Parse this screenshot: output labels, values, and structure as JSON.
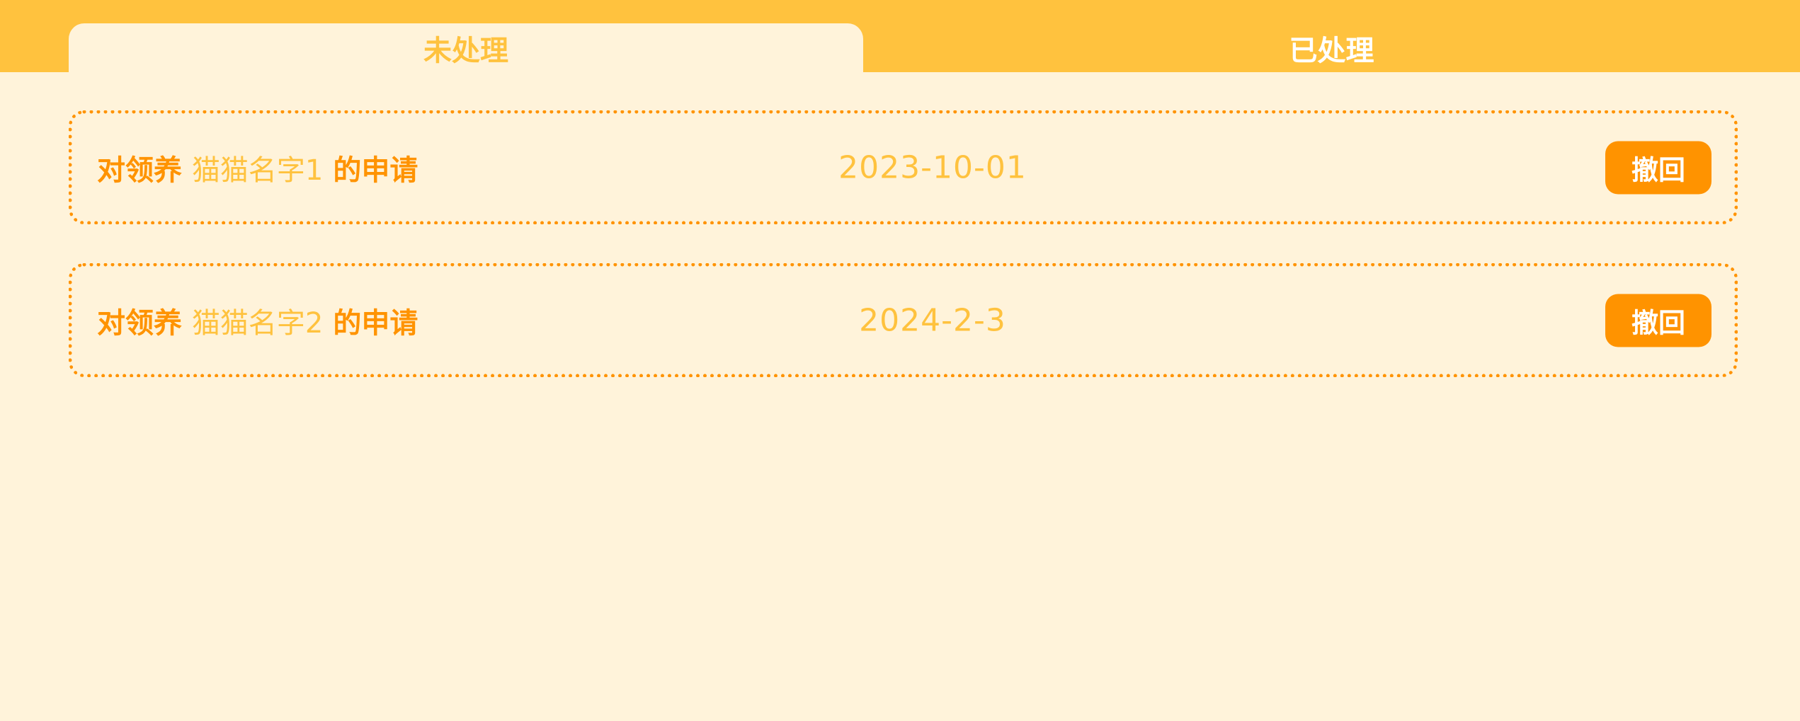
{
  "colors": {
    "background": "#FFF3DA",
    "tab_bar": "#FFC23E",
    "accent": "#FF9300",
    "highlight": "#FFC23E"
  },
  "tabs": [
    {
      "label": "未处理",
      "active": true
    },
    {
      "label": "已处理",
      "active": false
    }
  ],
  "applications": [
    {
      "prefix": "对领养",
      "cat_name": "猫猫名字1",
      "suffix": "的申请",
      "date": "2023-10-01",
      "action_label": "撤回"
    },
    {
      "prefix": "对领养",
      "cat_name": "猫猫名字2",
      "suffix": "的申请",
      "date": "2024-2-3",
      "action_label": "撤回"
    }
  ]
}
